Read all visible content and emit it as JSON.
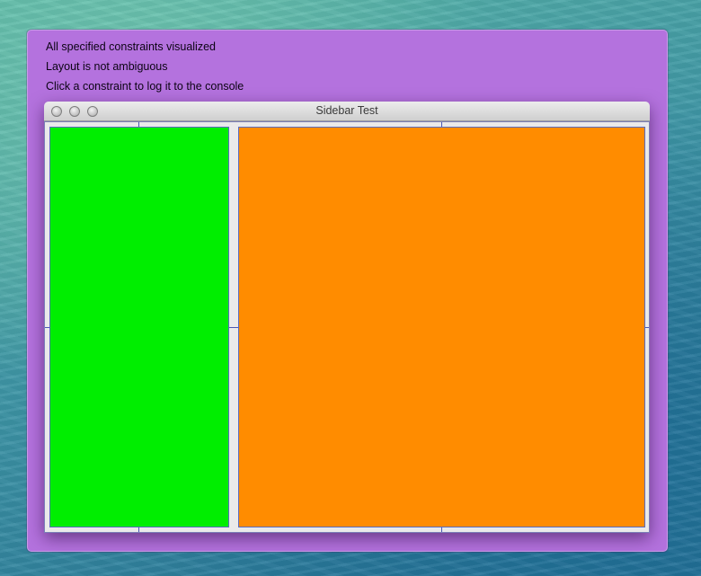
{
  "overlay": {
    "lines": [
      "All specified constraints visualized",
      "Layout is not ambiguous",
      "Click a constraint to log it to the console"
    ],
    "background": "#b472de"
  },
  "window": {
    "title": "Sidebar Test",
    "traffic_lights": [
      "close-button",
      "minimize-button",
      "zoom-button"
    ]
  },
  "views": {
    "sidebar_color": "#00ee00",
    "main_color": "#ff8c00"
  }
}
